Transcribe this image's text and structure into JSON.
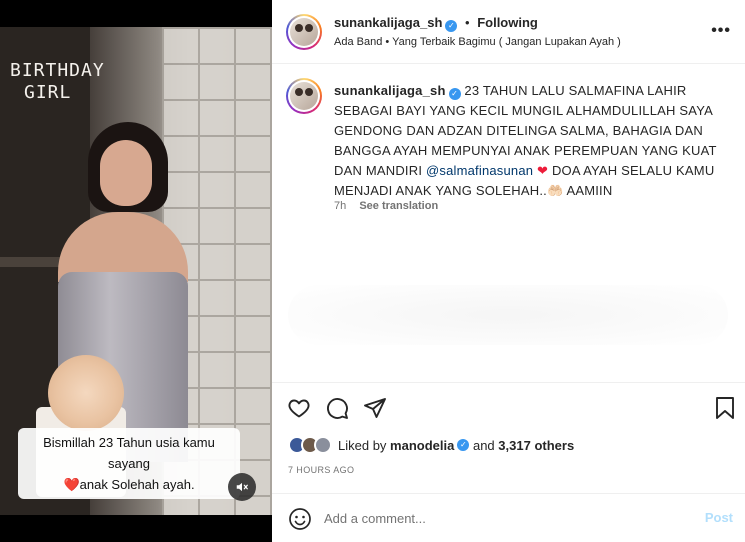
{
  "media": {
    "overlay_line1": "BIRTHDAY",
    "overlay_line2": "GIRL",
    "caption_line1": "Bismillah 23 Tahun usia kamu sayang",
    "caption_heart": "❤️",
    "caption_line2": "anak Solehah ayah.",
    "mute_icon": "speaker-muted-icon"
  },
  "header": {
    "username": "sunankalijaga_sh",
    "separator": "•",
    "follow_label": "Following",
    "audio_artist": "Ada Band",
    "audio_separator": "•",
    "audio_title": "Yang Terbaik Bagimu ( Jangan Lupakan Ayah )",
    "more_label": "•••"
  },
  "caption": {
    "username": "sunankalijaga_sh",
    "text_part1": "23 TAHUN LALU SALMAFINA LAHIR SEBAGAI BAYI YANG KECIL MUNGIL ALHAMDULILLAH SAYA GENDONG DAN ADZAN DITELINGA SALMA, BAHAGIA DAN BANGGA AYAH MEMPUNYAI ANAK PEREMPUAN YANG KUAT DAN MANDIRI ",
    "mention": "@salmafinasunan",
    "heart": "❤",
    "text_part2": " DOA AYAH SELALU KAMU MENJADI ANAK YANG SOLEHAH..",
    "hands": "🤲🏻",
    "text_part3": " AAMIIN",
    "age": "7h",
    "see_translation": "See translation"
  },
  "actions": {
    "like_icon": "heart-icon",
    "comment_icon": "comment-icon",
    "share_icon": "paper-plane-icon",
    "save_icon": "bookmark-icon"
  },
  "likes": {
    "prefix": "Liked by",
    "user": "manodelia",
    "and_label": "and",
    "count": "3,317 others"
  },
  "timestamp": "7 HOURS AGO",
  "comment_box": {
    "placeholder": "Add a comment...",
    "post_label": "Post"
  },
  "colors": {
    "link": "#00376b",
    "verified": "#3897f0",
    "post_disabled": "#b2dffc",
    "heart": "#ed1c3a"
  }
}
